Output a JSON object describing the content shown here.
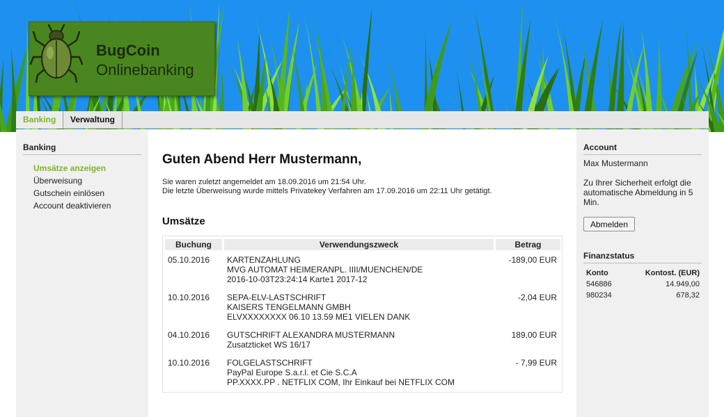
{
  "brand": {
    "name": "BugCoin",
    "subtitle": "Onlinebanking"
  },
  "nav": {
    "tabs": [
      {
        "label": "Banking",
        "active": true
      },
      {
        "label": "Verwaltung",
        "active": false
      }
    ]
  },
  "sidebar": {
    "heading": "Banking",
    "items": [
      {
        "label": "Umsätze anzeigen",
        "active": true
      },
      {
        "label": "Überweisung",
        "active": false
      },
      {
        "label": "Gutschein einlösen",
        "active": false
      },
      {
        "label": "Account deaktivieren",
        "active": false
      }
    ]
  },
  "main": {
    "greeting": "Guten Abend Herr Mustermann,",
    "last_login": "Sie waren zuletzt angemeldet am 18.09.2016 um 21:54 Uhr.",
    "last_transfer": "Die letzte Überweisung wurde mittels Privatekey Verfahren am 17.09.2016 um 22:11 Uhr getätigt.",
    "transactions_title": "Umsätze",
    "columns": [
      "Buchung",
      "Verwendungszweck",
      "Betrag"
    ],
    "transactions": [
      {
        "date": "05.10.2016",
        "purpose": [
          "KARTENZAHLUNG",
          "MVG AUTOMAT HEIMERANPL. IIII/MUENCHEN/DE",
          "2016-10-03T23:24:14 Karte1 2017-12"
        ],
        "amount": "-189,00 EUR"
      },
      {
        "date": "10.10.2016",
        "purpose": [
          "SEPA-ELV-LASTSCHRIFT",
          "KAISERS TENGELMANN GMBH",
          "ELVXXXXXXXX 06.10 13.59 ME1 VIELEN DANK"
        ],
        "amount": "-2,04 EUR"
      },
      {
        "date": "04.10.2016",
        "purpose": [
          "GUTSCHRIFT ALEXANDRA MUSTERMANN",
          "Zusatzticket WS 16/17"
        ],
        "amount": "189,00 EUR"
      },
      {
        "date": "10.10.2016",
        "purpose": [
          "FOLGELASTSCHRIFT",
          "PayPal Europe S.a.r.l. et Cie S.C.A",
          "PP.XXXX.PP . NETFLIX COM, Ihr Einkauf bei NETFLIX COM"
        ],
        "amount": "- 7,99 EUR"
      }
    ]
  },
  "account": {
    "heading": "Account",
    "name": "Max Mustermann",
    "note": "Zu Ihrer Sicherheit erfolgt die automatische Abmeldung in 5 Min.",
    "logout_label": "Abmelden"
  },
  "finance": {
    "heading": "Finanzstatus",
    "col_account": "Konto",
    "col_balance": "Kontost. (EUR)",
    "rows": [
      {
        "konto": "546886",
        "balance": "14.949,00"
      },
      {
        "konto": "980234",
        "balance": "678,32"
      }
    ]
  },
  "colors": {
    "accent_green": "#7cb526",
    "logo_green": "#4a861f",
    "sky_blue": "#1e90f0"
  }
}
